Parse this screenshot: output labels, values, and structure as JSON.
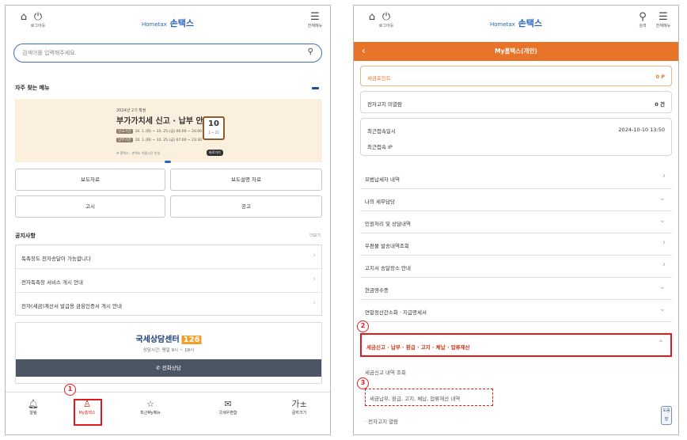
{
  "left": {
    "topbar": {
      "home_icon": "home-icon",
      "logout_icon": "power-icon",
      "logout_label": "로그아웃",
      "logo": "손택스",
      "logo_sub": "Hometax",
      "menu_label": "전체메뉴"
    },
    "search": {
      "placeholder": "검색어를 입력해주세요."
    },
    "favorites": {
      "title": "자주 찾는 메뉴"
    },
    "banner": {
      "year": "2024년 2기 확정",
      "title": "부가가치세 신고 · 납부 안내",
      "row1_tag": "신고기간",
      "row1": "10. 1.(화) ~ 10. 25.(금) 06:00 ~ 24:00",
      "row2_tag": "납부기한",
      "row2": "10. 1.(화) ~ 10. 25.(금) 07:00 ~ 23:30",
      "note": "※ 홈택스 · 손택스 이용시간 안내",
      "button": "바로가기",
      "calendar_num": "10",
      "calendar_sub": "1 ~ 25"
    },
    "grid": {
      "press": "보도자료",
      "press_desc": "보도설명 자료",
      "notice": "고시",
      "announce": "공고"
    },
    "notice": {
      "title": "공지사항",
      "more": "더보기",
      "items": [
        "독촉장도 전자송달이 가능합니다",
        "전자독촉장 서비스 개시 안내",
        "전자(세금)계산서 발급용 금융인증서 개시 안내"
      ]
    },
    "consult": {
      "name": "국세상담센터",
      "number": "126",
      "hours": "상담시간: 평일 9시 ~ 18시",
      "call": "전화상담"
    },
    "bottom_nav": [
      {
        "label": "알림",
        "icon": "bell-icon"
      },
      {
        "label": "My홈택스",
        "icon": "person-icon"
      },
      {
        "label": "최근My메뉴",
        "icon": "star-icon"
      },
      {
        "label": "국세우편함",
        "icon": "mail-icon"
      },
      {
        "label": "글자크기",
        "icon": "text-size-icon"
      }
    ],
    "markers": {
      "m1": "1"
    }
  },
  "right": {
    "topbar": {
      "logout_label": "로그아웃",
      "logo": "손택스",
      "logo_sub": "Hometax",
      "search_label": "검색",
      "menu_label": "전체메뉴"
    },
    "header": {
      "title": "My홈택스(개인)"
    },
    "points": {
      "label": "세금포인트",
      "value": "0 P"
    },
    "unread": {
      "label": "전자고지 미열람",
      "value": "0 건"
    },
    "last_login": {
      "label": "최근접속일시",
      "value": "2024-10-10 13:50",
      "ip_label": "최근접속 IP"
    },
    "menus": [
      "모범납세자 내역",
      "나의 세무담당",
      "민원처리 및 상담내역",
      "우편물 발송내역조회",
      "고지서 송달장소 안내",
      "현금영수증",
      "연말정산간소화 · 지급명세서",
      "세금신고 · 납부 · 환급 · 고지 · 체납 · 압류재산"
    ],
    "sub_items": [
      "세금신고 내역 조회",
      "세금납부, 환급, 고지, 체납, 압류재산 내역",
      "· 전자고지 열람"
    ],
    "side_button": "도움말",
    "markers": {
      "m2": "2",
      "m3": "3"
    }
  }
}
